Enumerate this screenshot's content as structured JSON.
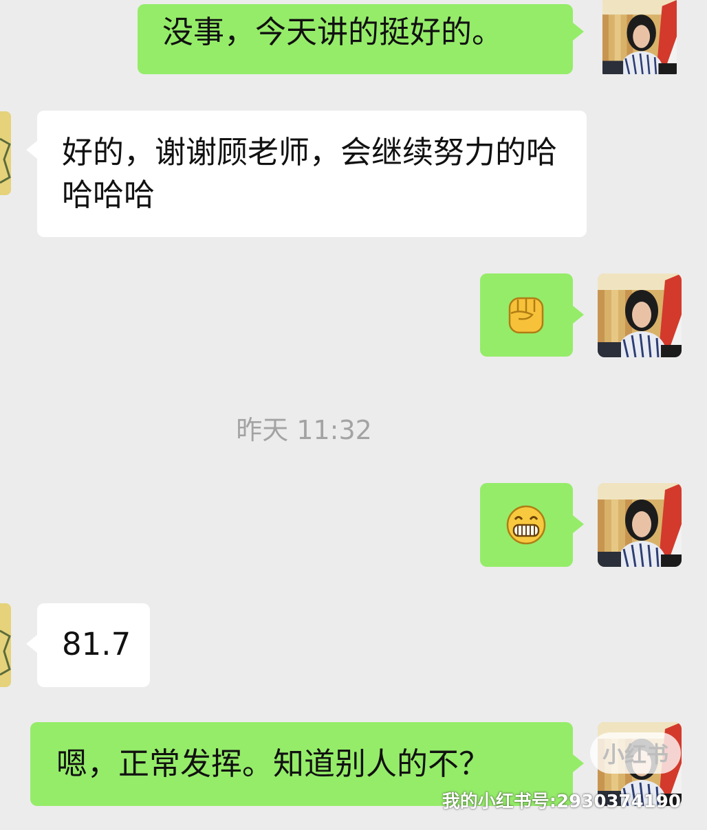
{
  "messages": [
    {
      "id": "m1",
      "sender": "me",
      "text": "没事，今天讲的挺好的。"
    },
    {
      "id": "m2",
      "sender": "them",
      "text": "好的，谢谢顾老师，会继续努力的哈哈哈哈"
    },
    {
      "id": "m3",
      "sender": "me",
      "emoji": "raised-fist-emoji"
    },
    {
      "id": "m4",
      "sender": "me",
      "emoji": "grinning-face-emoji"
    },
    {
      "id": "m5",
      "sender": "them",
      "text": "81.7"
    },
    {
      "id": "m6",
      "sender": "me",
      "text": "嗯，正常发挥。知道别人的不？"
    }
  ],
  "timestamp": "昨天 11:32",
  "watermark": {
    "badge": "小红书",
    "text": "我的小红书号:2930374190"
  },
  "colors": {
    "background": "#ececec",
    "my_bubble": "#95ec69",
    "their_bubble": "#ffffff",
    "timestamp": "#a3a3a3"
  }
}
